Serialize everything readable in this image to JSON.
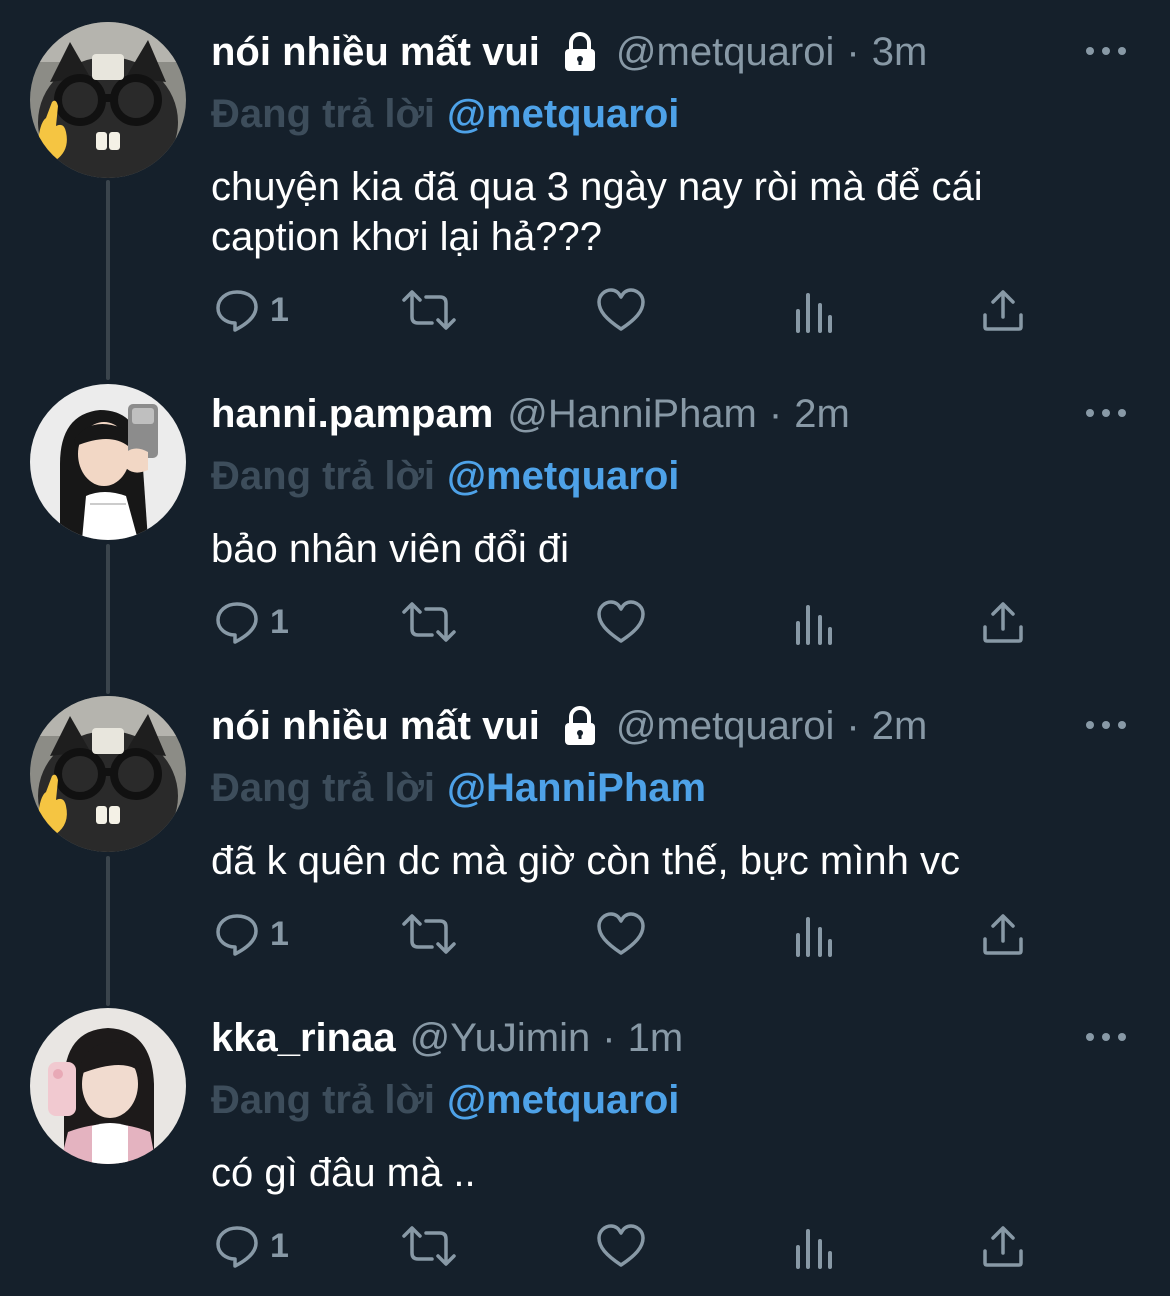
{
  "tweets": [
    {
      "name": "nói nhiều mất vui",
      "locked": true,
      "handle": "@metquaroi",
      "dot": "·",
      "time": "3m",
      "replying_label": "Đang trả lời",
      "replying_to": "@metquaroi",
      "text": "chuyện kia đã qua 3 ngày nay ròi mà để cái caption khơi lại hả???",
      "reply_count": "1",
      "avatar": "cat-avatar"
    },
    {
      "name": "hanni.pampam",
      "locked": false,
      "handle": "@HanniPham",
      "dot": "·",
      "time": "2m",
      "replying_label": "Đang trả lời",
      "replying_to": "@metquaroi",
      "text": "bảo nhân viên đổi đi",
      "reply_count": "1",
      "avatar": "girl-selfie-avatar"
    },
    {
      "name": "nói nhiều mất vui",
      "locked": true,
      "handle": "@metquaroi",
      "dot": "·",
      "time": "2m",
      "replying_label": "Đang trả lời",
      "replying_to": "@HanniPham",
      "text": "đã k quên dc mà giờ còn thế, bực mình vc",
      "reply_count": "1",
      "avatar": "cat-avatar"
    },
    {
      "name": "kka_rinaa",
      "locked": false,
      "handle": "@YuJimin",
      "dot": "·",
      "time": "1m",
      "replying_label": "Đang trả lời",
      "replying_to": "@metquaroi",
      "text": "có gì đâu mà ..",
      "reply_count": "1",
      "avatar": "girl-phone-avatar"
    }
  ],
  "icons": {
    "reply": "reply-icon",
    "retweet": "retweet-icon",
    "like": "heart-icon",
    "views": "views-icon",
    "share": "share-icon",
    "lock": "lock-icon",
    "more": "more-icon"
  },
  "colors": {
    "background": "#15202b",
    "secondary_text": "#8899a6",
    "mention": "#4ea2e8",
    "replying_label": "#3d4d5b",
    "thread_line": "#3a444c"
  }
}
